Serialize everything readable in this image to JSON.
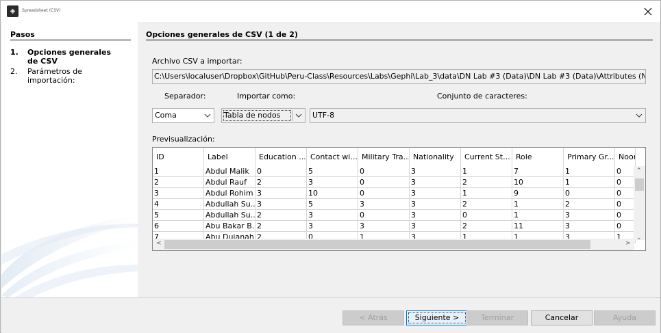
{
  "window": {
    "title": "Spreadsheet (CSV)"
  },
  "sidebar": {
    "title": "Pasos",
    "steps": [
      {
        "num": "1.",
        "label": "Opciones generales de CSV"
      },
      {
        "num": "2.",
        "label": "Parámetros de importación:"
      }
    ]
  },
  "main": {
    "title": "Opciones generales de CSV (1 de 2)",
    "file_label": "Archivo CSV a importar:",
    "file_path": "C:\\Users\\localuser\\Dropbox\\GitHub\\Peru-Class\\Resources\\Labs\\Gephi\\Lab_3\\data\\DN Lab #3 (Data)\\DN Lab #3 (Data)\\Attributes (Nodes Table).csv",
    "separator_label": "Separador:",
    "import_as_label": "Importar como:",
    "charset_label": "Conjunto de caracteres:",
    "separator_value": "Coma",
    "import_as_value": "Tabla de nodos",
    "charset_value": "UTF-8",
    "preview_label": "Previsualización:"
  },
  "preview": {
    "columns": [
      "ID",
      "Label",
      "Education ...",
      "Contact wi...",
      "Military Tra...",
      "Nationality",
      "Current St...",
      "Role",
      "Primary Gr...",
      "Noor"
    ],
    "rows": [
      [
        "1",
        "Abdul Malik",
        "0",
        "5",
        "0",
        "3",
        "1",
        "7",
        "1",
        "0"
      ],
      [
        "2",
        "Abdul Rauf",
        "2",
        "3",
        "0",
        "3",
        "2",
        "10",
        "1",
        "0"
      ],
      [
        "3",
        "Abdul Rohim",
        "3",
        "10",
        "0",
        "3",
        "1",
        "9",
        "0",
        "0"
      ],
      [
        "4",
        "Abdullah Su...",
        "3",
        "5",
        "3",
        "3",
        "2",
        "1",
        "2",
        "0"
      ],
      [
        "5",
        "Abdullah Su...",
        "2",
        "3",
        "0",
        "3",
        "0",
        "1",
        "3",
        "0"
      ],
      [
        "6",
        "Abu Bakar B...",
        "2",
        "3",
        "3",
        "3",
        "2",
        "11",
        "3",
        "0"
      ],
      [
        "7",
        "Abu Dujanah",
        "2",
        "0",
        "1",
        "3",
        "1",
        "1",
        "3",
        "1"
      ]
    ]
  },
  "footer": {
    "back": "< Atrás",
    "next": "Siguiente >",
    "finish": "Terminar",
    "cancel": "Cancelar",
    "help": "Ayuda"
  }
}
